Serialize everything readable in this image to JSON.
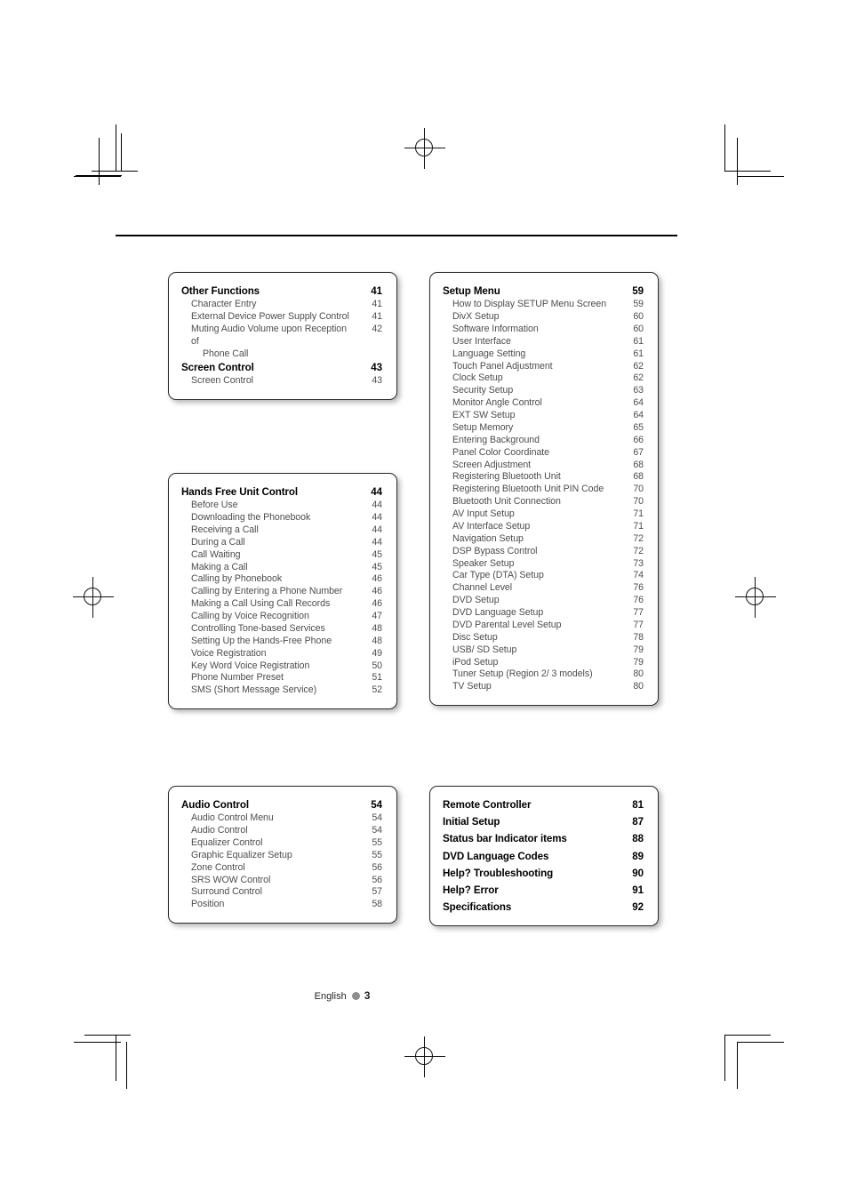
{
  "page": {
    "footer_language": "English",
    "footer_page_number": "3"
  },
  "boxes": {
    "other_functions": {
      "name": "Other Functions",
      "entries": [
        {
          "type": "head",
          "title": "Other Functions",
          "page": "41"
        },
        {
          "type": "sub",
          "title": "Character Entry",
          "page": "41"
        },
        {
          "type": "sub",
          "title": "External Device Power Supply Control",
          "page": "41"
        },
        {
          "type": "sub",
          "title": "Muting Audio Volume upon Reception of",
          "cont": "Phone Call",
          "page": "42"
        },
        {
          "type": "head",
          "title": "Screen Control",
          "page": "43"
        },
        {
          "type": "sub",
          "title": "Screen Control",
          "page": "43"
        }
      ]
    },
    "hands_free": {
      "name": "Hands Free Unit Control",
      "entries": [
        {
          "type": "head",
          "title": "Hands Free Unit Control",
          "page": "44"
        },
        {
          "type": "sub",
          "title": "Before Use",
          "page": "44"
        },
        {
          "type": "sub",
          "title": "Downloading the Phonebook",
          "page": "44"
        },
        {
          "type": "sub",
          "title": "Receiving a Call",
          "page": "44"
        },
        {
          "type": "sub",
          "title": "During a Call",
          "page": "44"
        },
        {
          "type": "sub",
          "title": "Call Waiting",
          "page": "45"
        },
        {
          "type": "sub",
          "title": "Making a Call",
          "page": "45"
        },
        {
          "type": "sub",
          "title": "Calling by Phonebook",
          "page": "46"
        },
        {
          "type": "sub",
          "title": "Calling by Entering a Phone Number",
          "page": "46"
        },
        {
          "type": "sub",
          "title": "Making a Call Using Call Records",
          "page": "46"
        },
        {
          "type": "sub",
          "title": "Calling by Voice Recognition",
          "page": "47"
        },
        {
          "type": "sub",
          "title": "Controlling Tone-based Services",
          "page": "48"
        },
        {
          "type": "sub",
          "title": "Setting Up the Hands-Free Phone",
          "page": "48"
        },
        {
          "type": "sub",
          "title": "Voice Registration",
          "page": "49"
        },
        {
          "type": "sub",
          "title": "Key Word Voice Registration",
          "page": "50"
        },
        {
          "type": "sub",
          "title": "Phone Number Preset",
          "page": "51"
        },
        {
          "type": "sub",
          "title": "SMS (Short Message Service)",
          "page": "52"
        }
      ]
    },
    "audio_control": {
      "name": "Audio Control",
      "entries": [
        {
          "type": "head",
          "title": "Audio Control",
          "page": "54"
        },
        {
          "type": "sub",
          "title": "Audio Control Menu",
          "page": "54"
        },
        {
          "type": "sub",
          "title": "Audio Control",
          "page": "54"
        },
        {
          "type": "sub",
          "title": "Equalizer Control",
          "page": "55"
        },
        {
          "type": "sub",
          "title": "Graphic Equalizer Setup",
          "page": "55"
        },
        {
          "type": "sub",
          "title": "Zone Control",
          "page": "56"
        },
        {
          "type": "sub",
          "title": "SRS WOW Control",
          "page": "56"
        },
        {
          "type": "sub",
          "title": "Surround Control",
          "page": "57"
        },
        {
          "type": "sub",
          "title": "Position",
          "page": "58"
        }
      ]
    },
    "setup_menu": {
      "name": "Setup Menu",
      "entries": [
        {
          "type": "head",
          "title": "Setup Menu",
          "page": "59"
        },
        {
          "type": "sub",
          "title": "How to Display SETUP Menu Screen",
          "page": "59"
        },
        {
          "type": "sub",
          "title": "DivX Setup",
          "page": "60"
        },
        {
          "type": "sub",
          "title": "Software Information",
          "page": "60"
        },
        {
          "type": "sub",
          "title": "User Interface",
          "page": "61"
        },
        {
          "type": "sub",
          "title": "Language Setting",
          "page": "61"
        },
        {
          "type": "sub",
          "title": "Touch Panel Adjustment",
          "page": "62"
        },
        {
          "type": "sub",
          "title": "Clock Setup",
          "page": "62"
        },
        {
          "type": "sub",
          "title": "Security Setup",
          "page": "63"
        },
        {
          "type": "sub",
          "title": "Monitor Angle Control",
          "page": "64"
        },
        {
          "type": "sub",
          "title": "EXT SW Setup",
          "page": "64"
        },
        {
          "type": "sub",
          "title": "Setup Memory",
          "page": "65"
        },
        {
          "type": "sub",
          "title": "Entering Background",
          "page": "66"
        },
        {
          "type": "sub",
          "title": "Panel Color Coordinate",
          "page": "67"
        },
        {
          "type": "sub",
          "title": "Screen Adjustment",
          "page": "68"
        },
        {
          "type": "sub",
          "title": "Registering Bluetooth Unit",
          "page": "68"
        },
        {
          "type": "sub",
          "title": "Registering Bluetooth Unit PIN Code",
          "page": "70"
        },
        {
          "type": "sub",
          "title": "Bluetooth Unit Connection",
          "page": "70"
        },
        {
          "type": "sub",
          "title": "AV Input Setup",
          "page": "71"
        },
        {
          "type": "sub",
          "title": "AV Interface Setup",
          "page": "71"
        },
        {
          "type": "sub",
          "title": "Navigation Setup",
          "page": "72"
        },
        {
          "type": "sub",
          "title": "DSP Bypass Control",
          "page": "72"
        },
        {
          "type": "sub",
          "title": "Speaker Setup",
          "page": "73"
        },
        {
          "type": "sub",
          "title": "Car Type (DTA) Setup",
          "page": "74"
        },
        {
          "type": "sub",
          "title": "Channel Level",
          "page": "76"
        },
        {
          "type": "sub",
          "title": "DVD Setup",
          "page": "76"
        },
        {
          "type": "sub",
          "title": "DVD Language Setup",
          "page": "77"
        },
        {
          "type": "sub",
          "title": "DVD Parental Level Setup",
          "page": "77"
        },
        {
          "type": "sub",
          "title": "Disc Setup",
          "page": "78"
        },
        {
          "type": "sub",
          "title": "USB/ SD Setup",
          "page": "79"
        },
        {
          "type": "sub",
          "title": "iPod Setup",
          "page": "79"
        },
        {
          "type": "sub",
          "title": "Tuner Setup (Region 2/ 3 models)",
          "page": "80"
        },
        {
          "type": "sub",
          "title": "TV Setup",
          "page": "80"
        }
      ]
    },
    "chapters": {
      "name": "Chapters",
      "entries": [
        {
          "type": "head",
          "title": "Remote Controller",
          "page": "81"
        },
        {
          "type": "head",
          "title": "Initial Setup",
          "page": "87"
        },
        {
          "type": "head",
          "title": "Status bar Indicator items",
          "page": "88"
        },
        {
          "type": "head",
          "title": "DVD Language Codes",
          "page": "89"
        },
        {
          "type": "head",
          "title": "Help? Troubleshooting",
          "page": "90"
        },
        {
          "type": "head",
          "title": "Help? Error",
          "page": "91"
        },
        {
          "type": "head",
          "title": "Specifications",
          "page": "92"
        }
      ]
    }
  }
}
